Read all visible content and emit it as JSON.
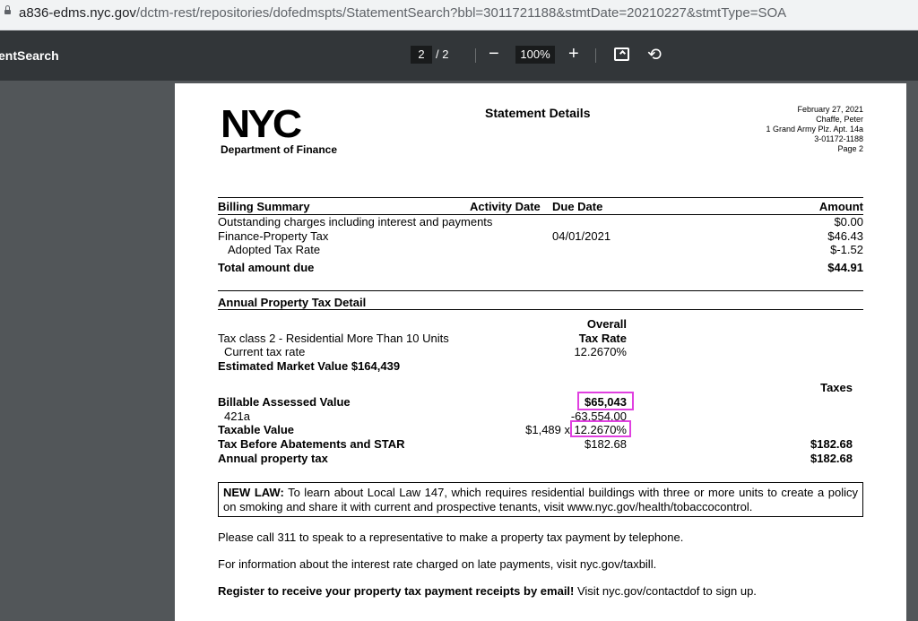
{
  "browser": {
    "url_host": "a836-edms.nyc.gov",
    "url_path": "/dctm-rest/repositories/dofedmspts/StatementSearch?bbl=3011721188&stmtDate=20210227&stmtType=SOA"
  },
  "viewer": {
    "doc_title": "entSearch",
    "current_page": "2",
    "page_sep": "/",
    "total_pages": "2",
    "zoom": "100%",
    "zoom_out": "−",
    "zoom_in": "+",
    "rotate": "⟲"
  },
  "statement": {
    "logo_text": "NYC",
    "dept": "Department of Finance",
    "title": "Statement Details",
    "header_right": {
      "date": "February 27, 2021",
      "name": "Chaffe, Peter",
      "address": "1 Grand Army Plz. Apt. 14a",
      "bbl": "3-01172-1188",
      "page": "Page  2"
    },
    "billing": {
      "headers": {
        "summary": "Billing Summary",
        "activity": "Activity Date",
        "due": "Due Date",
        "amount": "Amount"
      },
      "rows": [
        {
          "label": "Outstanding charges including interest and payments",
          "due": "",
          "amount": "$0.00"
        },
        {
          "label": "Finance-Property Tax",
          "due": "04/01/2021",
          "amount": "$46.43"
        },
        {
          "label": "Adopted Tax Rate",
          "due": "",
          "amount": "$-1.52"
        }
      ],
      "total_label": "Total amount due",
      "total_amount": "$44.91"
    },
    "annual": {
      "heading": "Annual Property Tax Detail",
      "overall": "Overall",
      "tax_rate_hdr": "Tax Rate",
      "tax_class": "Tax class   2 -  Residential More Than 10 Units",
      "current_rate_label": "Current tax rate",
      "current_rate": "12.2670%",
      "market_value": "Estimated Market Value   $164,439",
      "taxes_hdr": "Taxes",
      "billable_label": "Billable Assessed Value",
      "billable_value": "$65,043",
      "abatement_label": "421a",
      "abatement_value": "-63,554.00",
      "taxable_label": "Taxable Value",
      "taxable_value": "$1,489 x",
      "taxable_rate": "12.2670%",
      "before_label": "Tax Before Abatements and STAR",
      "before_mid": "$182.68",
      "before_tax": "$182.68",
      "annual_label": "Annual property tax",
      "annual_tax": "$182.68"
    },
    "new_law_label": "NEW LAW:",
    "new_law_text": " To learn about Local Law 147, which requires residential buildings with three or more units to create a policy on smoking and share it with current and prospective tenants, visit www.nyc.gov/health/tobaccocontrol.",
    "call_311": "Please call 311 to speak to a representative to make a property tax payment by telephone.",
    "interest_info": "For information about the interest rate charged on late payments, visit nyc.gov/taxbill.",
    "register_bold": "Register to receive your property tax payment receipts by email!",
    "register_rest": " Visit nyc.gov/contactdof to sign up."
  },
  "colors": {
    "highlight": "#e040e0",
    "toolbar": "#323639",
    "viewer_bg": "#525659"
  }
}
